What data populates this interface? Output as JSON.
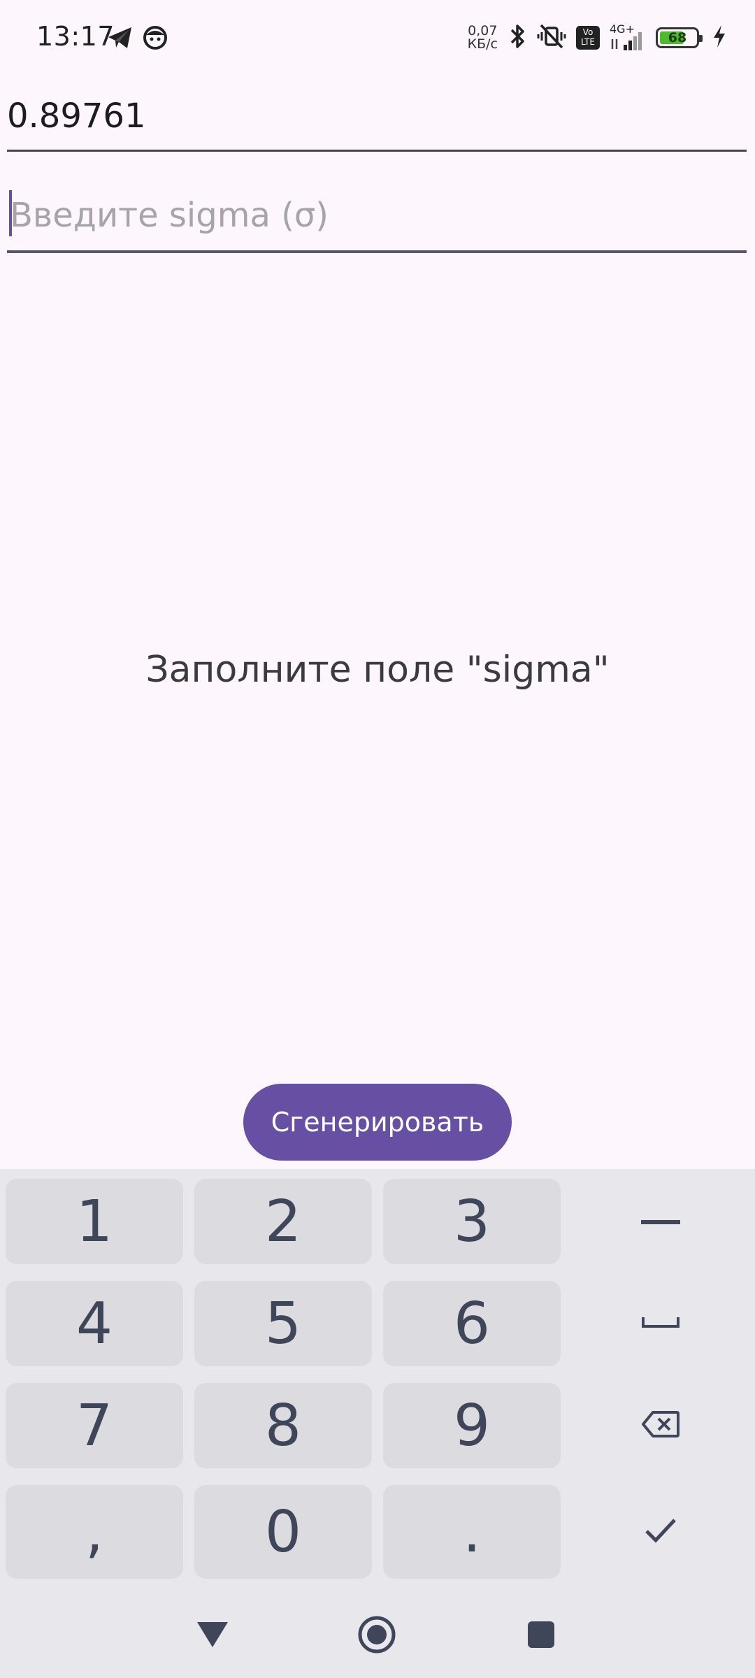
{
  "status_bar": {
    "time": "13:17",
    "left_icons": [
      "telegram-icon",
      "app-face-icon"
    ],
    "net_speed_value": "0,07",
    "net_speed_unit": "КБ/с",
    "volte_label": "Vo LTE",
    "network_type": "4G+",
    "battery_percent": "68",
    "right_icons": [
      "bluetooth-icon",
      "vibrate-off-icon",
      "volte-icon",
      "signal-icon",
      "battery-icon",
      "charging-icon"
    ]
  },
  "fields": {
    "first_value": "0.89761",
    "sigma_placeholder": "Введите sigma (σ)",
    "sigma_value": ""
  },
  "message": "Заполните поле \"sigma\"",
  "generate_button": "Сгенерировать",
  "keyboard": {
    "keys": [
      "1",
      "2",
      "3",
      "4",
      "5",
      "6",
      "7",
      "8",
      "9",
      ",",
      "0",
      "."
    ],
    "function_keys": [
      "minus-icon",
      "space-icon",
      "backspace-icon",
      "checkmark-icon"
    ]
  },
  "nav_bar": [
    "back-icon",
    "home-icon",
    "recents-icon"
  ],
  "colors": {
    "background": "#fdf7fd",
    "accent": "#6750a4",
    "keyboard_bg": "#e8e8ec",
    "key_bg": "#dcdce0",
    "key_text": "#3f4659"
  }
}
